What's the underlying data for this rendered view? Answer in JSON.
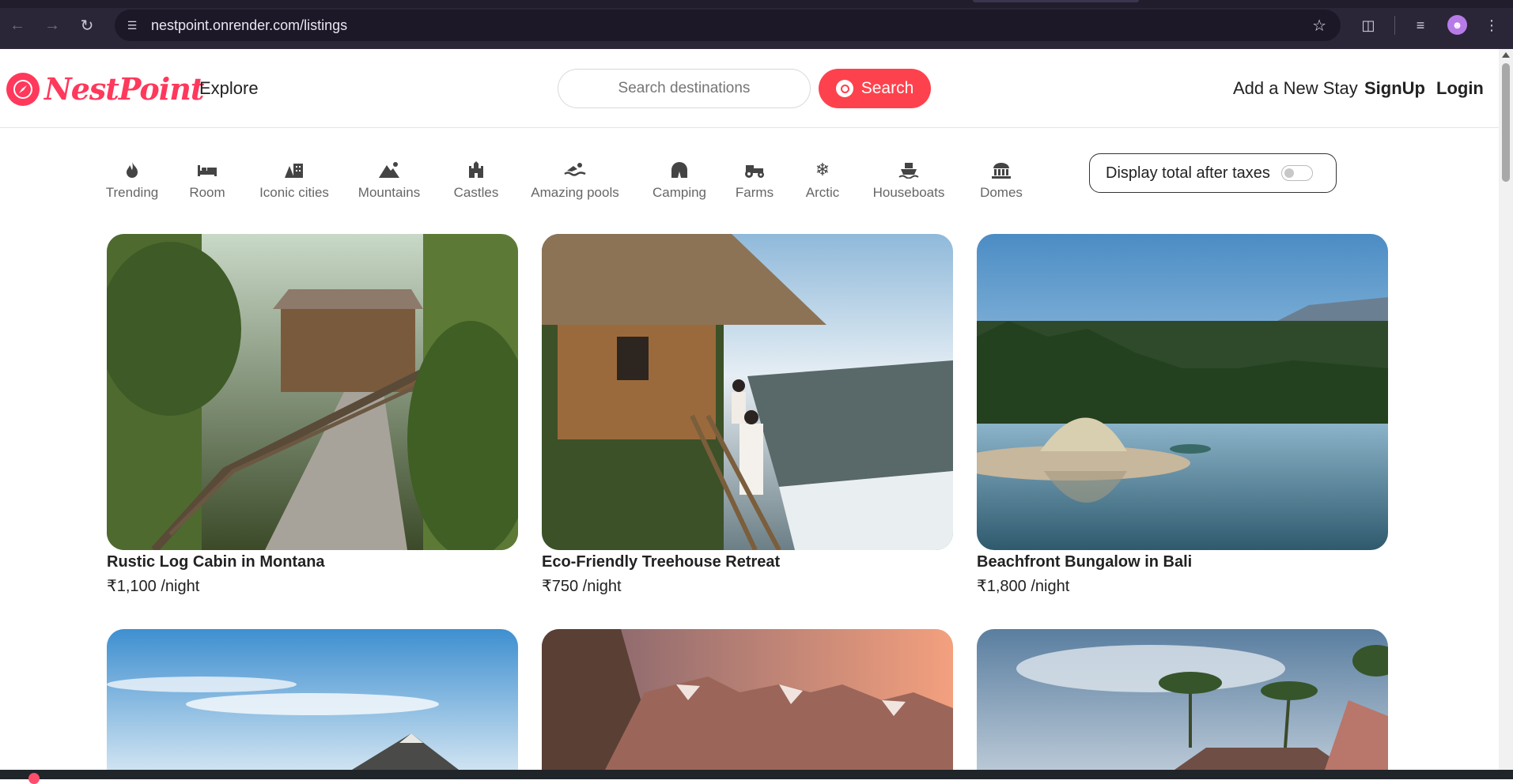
{
  "browser": {
    "url": "nestpoint.onrender.com/listings",
    "icons": [
      "back-arrow-icon",
      "forward-arrow-icon",
      "reload-icon",
      "site-info-icon",
      "bookmark-star-icon",
      "extensions-icon",
      "media-queue-icon",
      "profile-avatar-icon",
      "more-menu-icon"
    ]
  },
  "header": {
    "brand": "NestPoint",
    "explore": "Explore",
    "search_placeholder": "Search destinations",
    "search_button": "Search",
    "add_stay": "Add a New Stay",
    "signup": "SignUp",
    "login": "Login"
  },
  "filters": [
    {
      "label": "Trending",
      "icon": "flame-icon"
    },
    {
      "label": "Room",
      "icon": "bed-icon"
    },
    {
      "label": "Iconic cities",
      "icon": "city-icon"
    },
    {
      "label": "Mountains",
      "icon": "mountain-icon"
    },
    {
      "label": "Castles",
      "icon": "castle-icon"
    },
    {
      "label": "Amazing pools",
      "icon": "swimmer-icon"
    },
    {
      "label": "Camping",
      "icon": "tent-icon"
    },
    {
      "label": "Farms",
      "icon": "tractor-icon"
    },
    {
      "label": "Arctic",
      "icon": "snowflake-icon"
    },
    {
      "label": "Houseboats",
      "icon": "ship-icon"
    },
    {
      "label": "Domes",
      "icon": "dome-icon"
    }
  ],
  "tax_toggle": {
    "label": "Display total after taxes",
    "enabled": false
  },
  "listings": [
    {
      "title": "Rustic Log Cabin in Montana",
      "price": "₹1,100 /night"
    },
    {
      "title": "Eco-Friendly Treehouse Retreat",
      "price": "₹750 /night"
    },
    {
      "title": "Beachfront Bungalow in Bali",
      "price": "₹1,800 /night"
    }
  ],
  "colors": {
    "brand": "#ff385c",
    "search_button": "#fe424d"
  }
}
